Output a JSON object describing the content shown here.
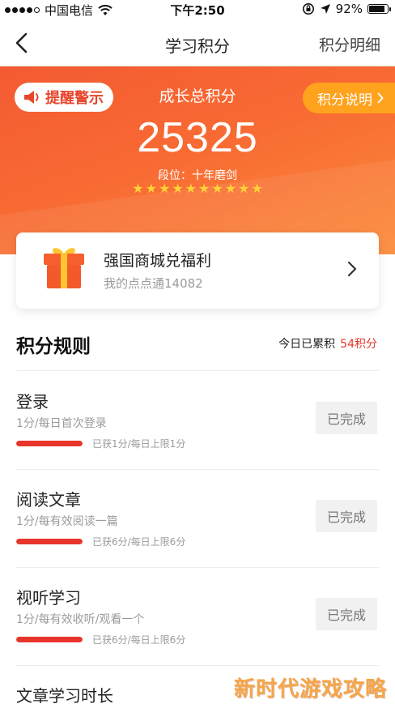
{
  "status_bar": {
    "carrier": "中国电信",
    "time": "下午2:50",
    "battery": "92%",
    "battery_level": 0.92,
    "signal_bars_filled": 4,
    "signal_bars_total": 5
  },
  "nav": {
    "title": "学习积分",
    "right_link": "积分明细"
  },
  "hero": {
    "alert_label": "提醒警示",
    "label": "成长总积分",
    "explain_label": "积分说明",
    "score": "25325",
    "level": "段位：十年磨剑",
    "stars": 10,
    "gradient_start": "#f45a32",
    "gradient_end": "#fb8a3a"
  },
  "mall": {
    "title": "强国商城兑福利",
    "subtitle": "我的点点通14082"
  },
  "rules": {
    "title": "积分规则",
    "today_label": "今日已累积",
    "today_points": "54积分",
    "items": [
      {
        "name": "登录",
        "desc": "1分/每日首次登录",
        "progress": "已获1分/每日上限1分",
        "ratio": 1.0,
        "status": "已完成"
      },
      {
        "name": "阅读文章",
        "desc": "1分/每有效阅读一篇",
        "progress": "已获6分/每日上限6分",
        "ratio": 1.0,
        "status": "已完成"
      },
      {
        "name": "视听学习",
        "desc": "1分/每有效收听/观看一个",
        "progress": "已获6分/每日上限6分",
        "ratio": 1.0,
        "status": "已完成"
      },
      {
        "name": "文章学习时长",
        "desc": "",
        "progress": "",
        "ratio": 0,
        "status": ""
      }
    ]
  },
  "colors": {
    "accent_red": "#e8352c",
    "accent_orange": "#ffa21e",
    "star": "#ffd23a"
  },
  "watermark": "新时代游戏攻略"
}
